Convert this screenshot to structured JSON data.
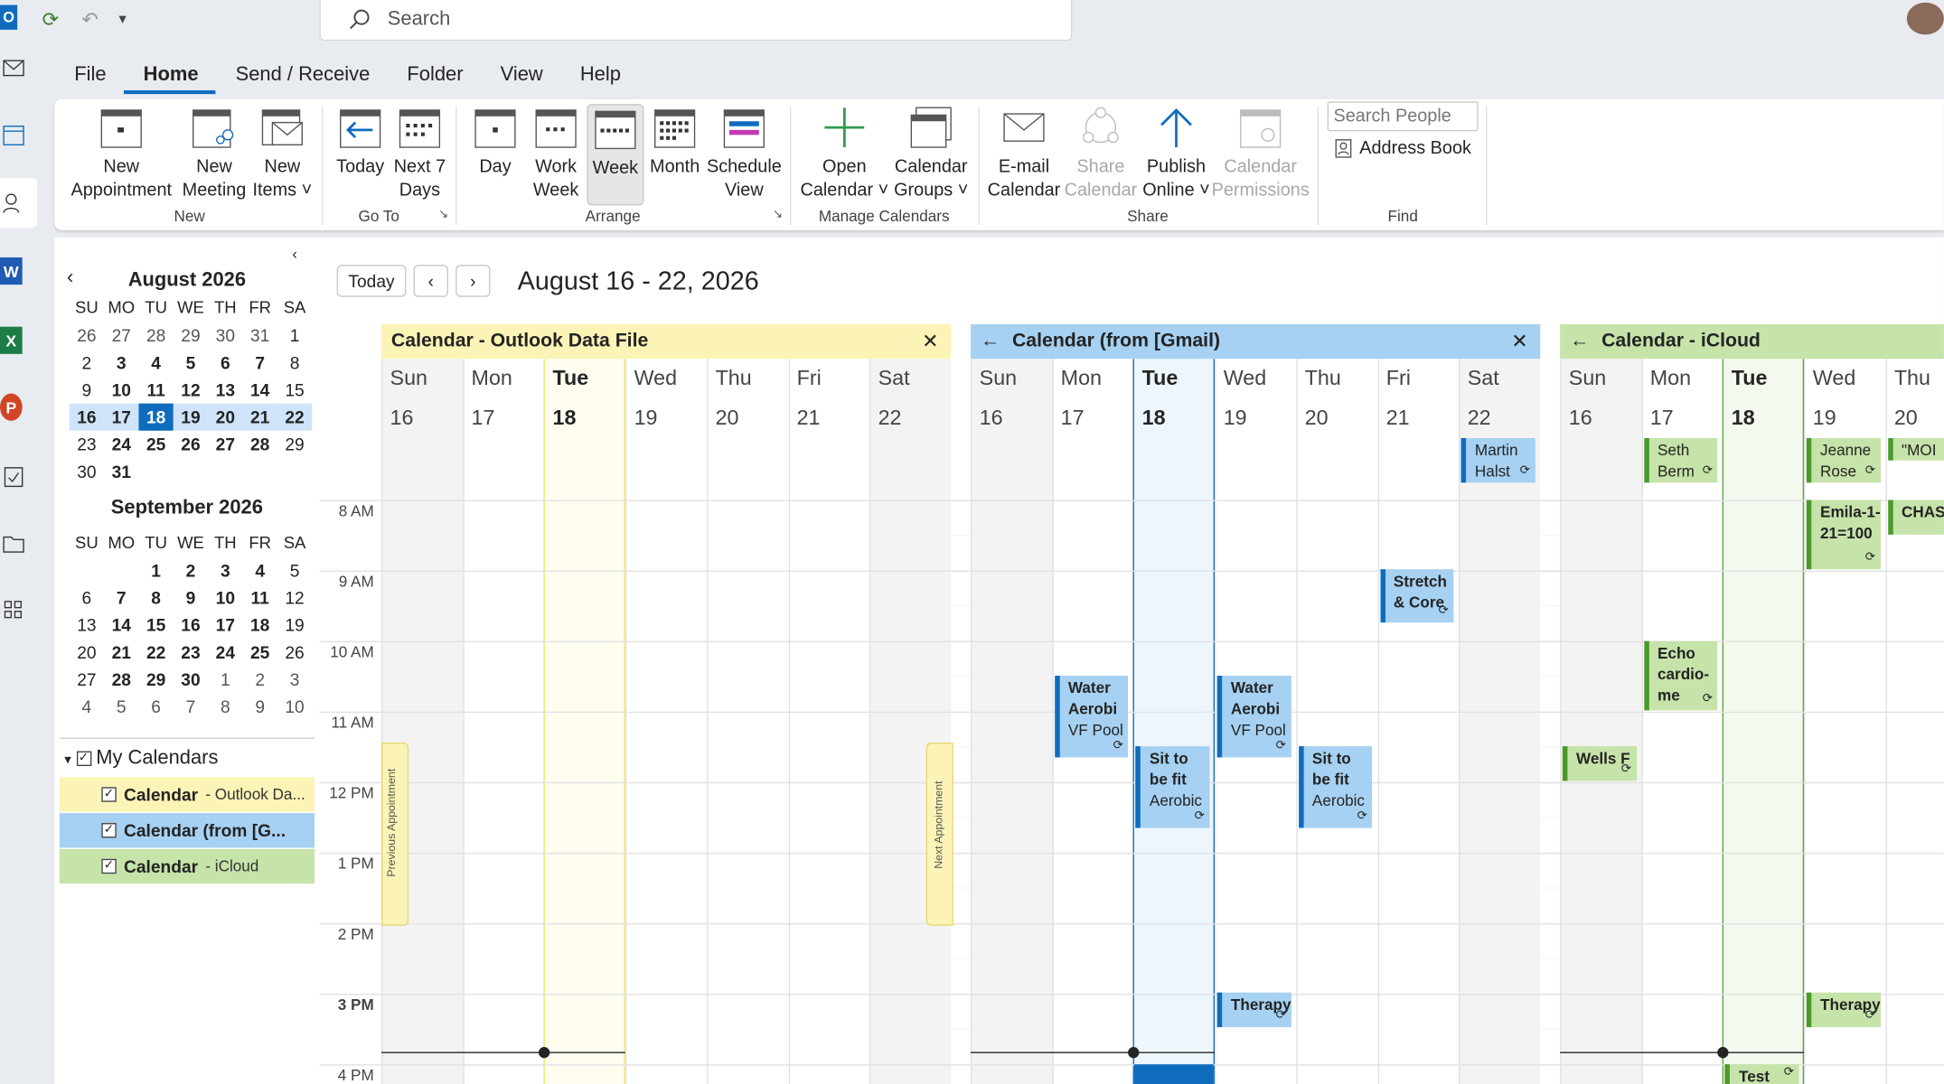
{
  "search": {
    "placeholder": "Search"
  },
  "menu": [
    "File",
    "Home",
    "Send / Receive",
    "Folder",
    "View",
    "Help"
  ],
  "ribbon": {
    "new_appointment": "New Appointment",
    "new_meeting": "New Meeting",
    "new_items": "New Items",
    "today": "Today",
    "next7": "Next 7 Days",
    "day": "Day",
    "work_week": "Work Week",
    "week": "Week",
    "month": "Month",
    "schedule_view": "Schedule View",
    "open_calendar": "Open Calendar",
    "calendar_groups": "Calendar Groups",
    "email_calendar": "E-mail Calendar",
    "share_calendar": "Share Calendar",
    "publish_online": "Publish Online",
    "calendar_permissions": "Calendar Permissions",
    "search_people": "Search People",
    "address_book": "Address Book",
    "groups": {
      "new": "New",
      "goto": "Go To",
      "arrange": "Arrange",
      "manage": "Manage Calendars",
      "share": "Share",
      "find": "Find"
    }
  },
  "mini": {
    "aug_title": "August 2026",
    "sep_title": "September 2026",
    "dow": [
      "SU",
      "MO",
      "TU",
      "WE",
      "TH",
      "FR",
      "SA"
    ],
    "aug": [
      [
        "26",
        "27",
        "28",
        "29",
        "30",
        "31",
        "1"
      ],
      [
        "2",
        "3",
        "4",
        "5",
        "6",
        "7",
        "8"
      ],
      [
        "9",
        "10",
        "11",
        "12",
        "13",
        "14",
        "15"
      ],
      [
        "16",
        "17",
        "18",
        "19",
        "20",
        "21",
        "22"
      ],
      [
        "23",
        "24",
        "25",
        "26",
        "27",
        "28",
        "29"
      ],
      [
        "30",
        "31",
        "",
        "",
        "",
        "",
        ""
      ]
    ],
    "sep": [
      [
        "",
        "",
        "1",
        "2",
        "3",
        "4",
        "5"
      ],
      [
        "6",
        "7",
        "8",
        "9",
        "10",
        "11",
        "12"
      ],
      [
        "13",
        "14",
        "15",
        "16",
        "17",
        "18",
        "19"
      ],
      [
        "20",
        "21",
        "22",
        "23",
        "24",
        "25",
        "26"
      ],
      [
        "27",
        "28",
        "29",
        "30",
        "1",
        "2",
        "3"
      ],
      [
        "4",
        "5",
        "6",
        "7",
        "8",
        "9",
        "10"
      ]
    ]
  },
  "mycal": {
    "title": "My Calendars",
    "items": [
      {
        "name": "Calendar",
        "sub": "- Outlook Da..."
      },
      {
        "name": "Calendar (from [G...",
        "sub": ""
      },
      {
        "name": "Calendar",
        "sub": "- iCloud"
      }
    ]
  },
  "main": {
    "today_btn": "Today",
    "range": "August 16 - 22, 2026",
    "prev_appt": "Previous Appointment",
    "next_appt": "Next Appointment"
  },
  "cal1": {
    "title": "Calendar - Outlook Data File"
  },
  "cal2": {
    "title": "Calendar (from [Gmail)"
  },
  "cal3": {
    "title": "Calendar - iCloud"
  },
  "days": [
    "Sun",
    "Mon",
    "Tue",
    "Wed",
    "Thu",
    "Fri",
    "Sat"
  ],
  "dates": [
    "16",
    "17",
    "18",
    "19",
    "20",
    "21",
    "22"
  ],
  "times": [
    "8 AM",
    "9 AM",
    "10 AM",
    "11 AM",
    "12 PM",
    "1 PM",
    "2 PM",
    "3 PM",
    "4 PM"
  ],
  "events": {
    "martin": "Martin Halst",
    "stretch": "Stretch & Core",
    "water1_t": "Water Aerobi",
    "water1_s": "VF Pool",
    "water2_t": "Water Aerobi",
    "water2_s": "VF Pool",
    "sit1_t": "Sit to be fit",
    "sit1_s": "Aerobic",
    "sit2_t": "Sit to be fit",
    "sit2_s": "Aerobic",
    "therapy1": "Therapy",
    "seth": "Seth Berm",
    "jeanne": "Jeanne Rose",
    "moi": "\"MOI",
    "emila": "Emila-1-21=100",
    "chase": "CHASE",
    "echo": "Echo cardio-me",
    "wells": "Wells F",
    "therapy2": "Therapy",
    "test": "Test"
  },
  "colors": {
    "accent": "#0f6cbd",
    "outlook_cal": "#fcf4b6",
    "gmail_cal": "#a6d1f2",
    "icloud_cal": "#c6e3a9"
  }
}
